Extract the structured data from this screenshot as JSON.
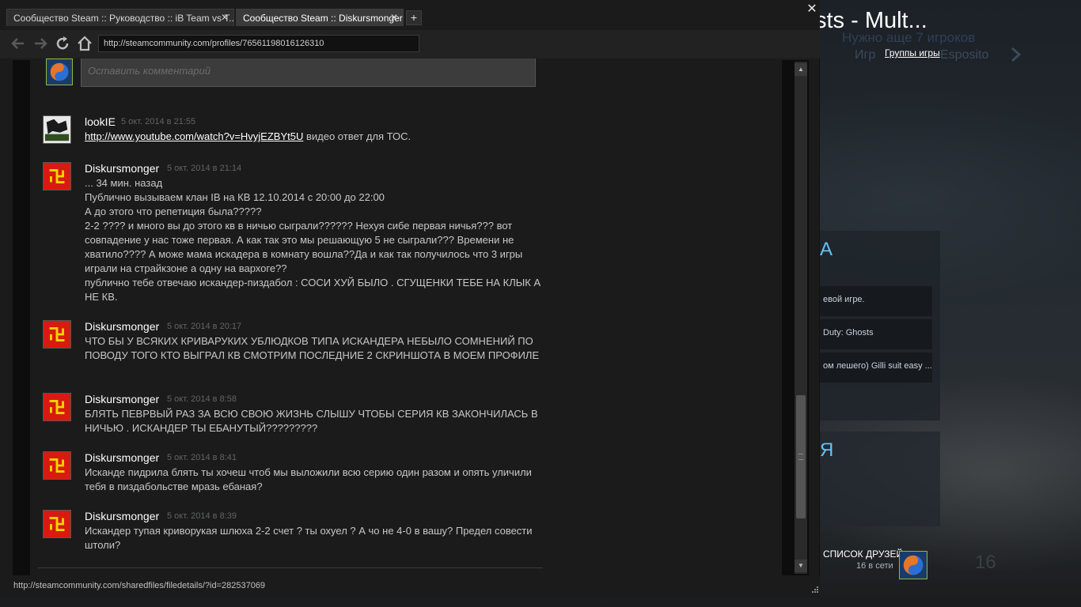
{
  "background": {
    "title": "sts - Mult...",
    "need_players": "Нужно аще 7 игроков",
    "games_label": "Игр",
    "games_name": "Esposito",
    "group_link": "Группы игры",
    "panel_accent": "A",
    "panel_rows": [
      "евой игре.",
      "Duty: Ghosts",
      "ом лешего) Gilli suit easy ..."
    ],
    "panel2_accent": "Я",
    "friends_label": "СПИСОК ДРУЗЕЙ",
    "friends_online": "16 в сети",
    "friends_count": "16"
  },
  "browser": {
    "tabs": [
      {
        "label": "Сообщество Steam :: Руководство :: iB Team vs T...",
        "active": false
      },
      {
        "label": "Сообщество Steam :: Diskursmonger",
        "active": true
      }
    ],
    "new_tab_label": "+",
    "close_label": "✕",
    "url": "http://steamcommunity.com/profiles/76561198016126310",
    "status_url": "http://steamcommunity.com/sharedfiles/filedetails/?id=282537069"
  },
  "comments_section": {
    "input_placeholder": "Оставить комментарий",
    "comments": [
      {
        "author": "lookIE",
        "date": "5 окт. 2014 в 21:55",
        "link": "http://www.youtube.com/watch?v=HvyjEZBYt5U",
        "lines": [
          " видео ответ для ТОС."
        ]
      },
      {
        "author": "Diskursmonger",
        "date": "5 окт. 2014 в 21:14",
        "lines": [
          "... 34 мин. назад",
          "Публично вызываем клан IB на КВ 12.10.2014 с 20:00 до 22:00",
          "А до этого что репетиция была?????",
          "2-2 ???? и много вы до этого кв в ничью сыграли?????? Нехуя сибе первая ничья??? вот совпадение у нас тоже первая. А как так это мы решающую 5 не сыграли??? Времени не хватило???? А може мама искадера в комнату вошла??Да и как так получилось что 3 игры играли на страйкзоне а одну на вархоге??",
          "публично тебе отвечаю искандер-пиздабол : СОСИ ХУЙ БЫЛО . СГУЩЕНКИ ТЕБЕ НА КЛЫК А НЕ КВ."
        ]
      },
      {
        "author": "Diskursmonger",
        "date": "5 окт. 2014 в 20:17",
        "lines": [
          "ЧТО БЫ У ВСЯКИХ КРИВАРУКИХ УБЛЮДКОВ ТИПА ИСКАНДЕРА НЕБЫЛО СОМНЕНИЙ ПО ПОВОДУ ТОГО КТО ВЫГРАЛ КВ СМОТРИМ ПОСЛЕДНИЕ 2 СКРИНШОТА В МОЕМ ПРОФИЛЕ"
        ]
      },
      {
        "author": "Diskursmonger",
        "date": "5 окт. 2014 в 8:58",
        "lines": [
          "БЛЯТЬ ПЕВРВЫЙ РАЗ ЗА ВСЮ СВОЮ ЖИЗНЬ СЛЫШУ ЧТОБЫ СЕРИЯ КВ ЗАКОНЧИЛАСЬ В НИЧЬЮ . ИСКАНДЕР ТЫ ЕБАНУТЫЙ?????????"
        ]
      },
      {
        "author": "Diskursmonger",
        "date": "5 окт. 2014 в 8:41",
        "lines": [
          "Исканде пидрила блять ты хочеш чтоб мы выложили всю серию один разом и опять уличили тебя в пиздабольстве мразь ебаная?"
        ]
      },
      {
        "author": "Diskursmonger",
        "date": "5 окт. 2014 в 8:39",
        "lines": [
          "Искандер тупая криворукая шлюха 2-2 счет ? ты охуел ? А чо не 4-0 в вашу? Предел совести штоли?"
        ]
      }
    ]
  },
  "colors": {
    "accent": "#67c1f5",
    "avatar_red": "#d81a10",
    "avatar_yellow": "#f5d400",
    "friend_border": "#8fb93b"
  }
}
